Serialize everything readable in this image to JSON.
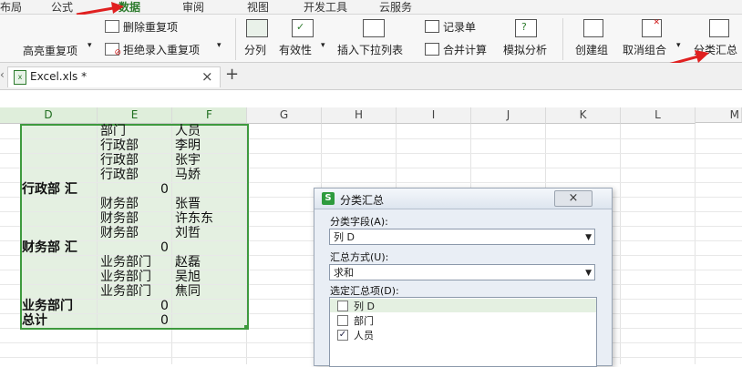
{
  "menubar": {
    "items": [
      "布局",
      "公式",
      "数据",
      "审阅",
      "视图",
      "开发工具",
      "云服务"
    ],
    "active_index": 2
  },
  "ribbon": {
    "highlight_duplicates": "高亮重复项",
    "delete_duplicates": "删除重复项",
    "reject_duplicates": "拒绝录入重复项",
    "split_column": "分列",
    "validity": "有效性",
    "insert_dropdown": "插入下拉列表",
    "record_form": "记录单",
    "consolidate": "合并计算",
    "what_if": "模拟分析",
    "create_group": "创建组",
    "ungroup": "取消组合",
    "subtotal": "分类汇总",
    "accent": "#2d7b2d"
  },
  "tabbar": {
    "file_name": "Excel.xls *",
    "close": "×",
    "add": "+"
  },
  "sheet": {
    "columns": [
      "D",
      "E",
      "F",
      "G",
      "H",
      "I",
      "J",
      "K",
      "L",
      "M"
    ],
    "cells": {
      "e1": "部门",
      "f1": "人员",
      "e2": "行政部",
      "f2": "李明",
      "e3": "行政部",
      "f3": "张宇",
      "e4": "行政部",
      "f4": "马娇",
      "d5": "行政部 汇",
      "e5": "0",
      "e6": "财务部",
      "f6": "张晋",
      "e7": "财务部",
      "f7": "许东东",
      "e8": "财务部",
      "f8": "刘哲",
      "d9": "财务部 汇",
      "e9": "0",
      "e10": "业务部门",
      "f10": "赵磊",
      "e11": "业务部门",
      "f11": "吴旭",
      "e12": "业务部门",
      "f12": "焦同",
      "d13": "业务部门",
      "e13": "0",
      "d14": "总计",
      "e14": "0"
    }
  },
  "dialog": {
    "title": "分类汇总",
    "close": "×",
    "group_field_label": "分类字段(A):",
    "group_field_value": "列 D",
    "summary_method_label": "汇总方式(U):",
    "summary_method_value": "求和",
    "subtotal_items_label": "选定汇总项(D):",
    "items": [
      {
        "label": "列 D",
        "checked": false
      },
      {
        "label": "部门",
        "checked": false
      },
      {
        "label": "人员",
        "checked": true
      }
    ]
  }
}
